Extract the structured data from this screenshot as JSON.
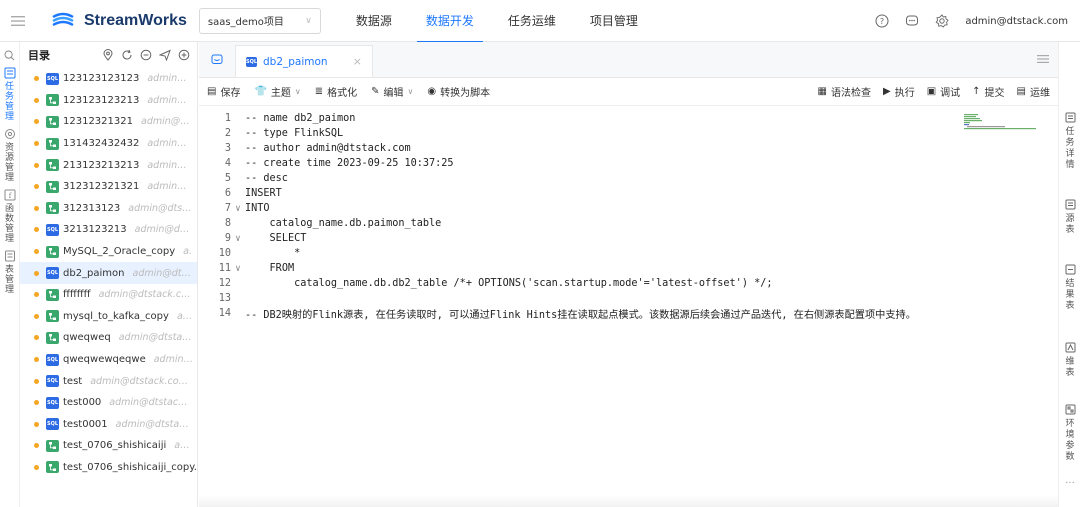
{
  "app": {
    "name": "StreamWorks"
  },
  "project_select": {
    "value": "saas_demo项目"
  },
  "topnav": [
    {
      "label": "数据源"
    },
    {
      "label": "数据开发"
    },
    {
      "label": "任务运维"
    },
    {
      "label": "项目管理"
    }
  ],
  "user": {
    "name": "admin@dtstack.com"
  },
  "rail": [
    {
      "label": "任务管理",
      "icon": "task-icon"
    },
    {
      "label": "资源管理",
      "icon": "resource-icon"
    },
    {
      "label": "函数管理",
      "icon": "function-icon"
    },
    {
      "label": "表管理",
      "icon": "table-icon"
    }
  ],
  "catalog": {
    "title": "目录",
    "items": [
      {
        "type": "SQL",
        "name": "123123123123",
        "owner": "admin@d..."
      },
      {
        "type": "flow",
        "name": "123123123213",
        "owner": "admin@d..."
      },
      {
        "type": "flow",
        "name": "12312321321",
        "owner": "admin@dt..."
      },
      {
        "type": "flow",
        "name": "131432432432",
        "owner": "admin@d..."
      },
      {
        "type": "flow",
        "name": "213123213213",
        "owner": "admin@d..."
      },
      {
        "type": "flow",
        "name": "312312321321",
        "owner": "admin@d..."
      },
      {
        "type": "flow",
        "name": "312313123",
        "owner": "admin@dtsta..."
      },
      {
        "type": "SQL",
        "name": "3213123213",
        "owner": "admin@dtst..."
      },
      {
        "type": "flow",
        "name": "MySQL_2_Oracle_copy",
        "owner": "a..."
      },
      {
        "type": "SQL",
        "name": "db2_paimon",
        "owner": "admin@dtst..."
      },
      {
        "type": "flow",
        "name": "ffffffff",
        "owner": "admin@dtstack.co..."
      },
      {
        "type": "flow",
        "name": "mysql_to_kafka_copy",
        "owner": "ad..."
      },
      {
        "type": "flow",
        "name": "qweqweq",
        "owner": "admin@dtstack..."
      },
      {
        "type": "SQL",
        "name": "qweqwewqeqwe",
        "owner": "admin@..."
      },
      {
        "type": "SQL",
        "name": "test",
        "owner": "admin@dtstack.com..."
      },
      {
        "type": "SQL",
        "name": "test000",
        "owner": "admin@dtstack.c..."
      },
      {
        "type": "SQL",
        "name": "test0001",
        "owner": "admin@dtstack..."
      },
      {
        "type": "flow",
        "name": "test_0706_shishicaiji",
        "owner": "ad..."
      },
      {
        "type": "flow",
        "name": "test_0706_shishicaiji_copy...",
        "owner": ""
      }
    ]
  },
  "tab": {
    "label": "db2_paimon",
    "type": "SQL"
  },
  "toolbar": {
    "left": [
      {
        "label": "保存",
        "icon": "save-icon",
        "dropdown": false
      },
      {
        "label": "主题",
        "icon": "theme-icon",
        "dropdown": true
      },
      {
        "label": "格式化",
        "icon": "format-icon",
        "dropdown": false
      },
      {
        "label": "编辑",
        "icon": "edit-icon",
        "dropdown": true
      },
      {
        "label": "转换为脚本",
        "icon": "convert-icon",
        "dropdown": false
      }
    ],
    "right": [
      {
        "label": "语法检查",
        "icon": "syntax-check-icon"
      },
      {
        "label": "执行",
        "icon": "run-icon"
      },
      {
        "label": "调试",
        "icon": "debug-icon"
      },
      {
        "label": "提交",
        "icon": "submit-icon"
      },
      {
        "label": "运维",
        "icon": "ops-icon"
      }
    ]
  },
  "code": [
    {
      "n": "1",
      "fold": "",
      "text": "-- name db2_paimon",
      "cls": "c-comment",
      "indent": ""
    },
    {
      "n": "2",
      "fold": "",
      "text": "-- type FlinkSQL",
      "cls": "c-comment",
      "indent": ""
    },
    {
      "n": "3",
      "fold": "",
      "text": "-- author admin@dtstack.com",
      "cls": "c-comment",
      "indent": ""
    },
    {
      "n": "4",
      "fold": "",
      "text": "-- create time 2023-09-25 10:37:25",
      "cls": "c-comment",
      "indent": ""
    },
    {
      "n": "5",
      "fold": "",
      "text": "-- desc",
      "cls": "c-comment",
      "indent": ""
    },
    {
      "n": "6",
      "fold": "",
      "text": "INSERT",
      "cls": "c-kw",
      "indent": ""
    },
    {
      "n": "7",
      "fold": "∨",
      "text": "INTO",
      "cls": "c-kw",
      "indent": ""
    },
    {
      "n": "8",
      "fold": "",
      "text": "catalog_name.db.paimon_table",
      "cls": "c-plain",
      "indent": "    "
    },
    {
      "n": "9",
      "fold": "∨",
      "text": "SELECT",
      "cls": "c-kw",
      "indent": "    "
    },
    {
      "n": "10",
      "fold": "",
      "text": "*",
      "cls": "c-plain",
      "indent": "        "
    },
    {
      "n": "11",
      "fold": "∨",
      "text": "FROM",
      "cls": "c-kw",
      "indent": "    "
    },
    {
      "n": "12",
      "fold": "",
      "text": "catalog_name.db.db2_table /*+ OPTIONS('scan.startup.mode'='latest-offset') */;",
      "cls": "c-plain",
      "indent": "        "
    },
    {
      "n": "13",
      "fold": "",
      "text": "",
      "cls": "c-plain",
      "indent": ""
    },
    {
      "n": "14",
      "fold": "",
      "text": "-- DB2映射的Flink源表, 在任务读取时, 可以通过Flink Hints挂在读取起点模式。该数据源后续会通过产品迭代, 在右侧源表配置项中支持。",
      "cls": "c-comment",
      "indent": ""
    }
  ],
  "right_rail": [
    {
      "label": "任务详情",
      "icon": "task-detail-icon"
    },
    {
      "label": "源表",
      "icon": "source-table-icon"
    },
    {
      "label": "结果表",
      "icon": "result-table-icon"
    },
    {
      "label": "维表",
      "icon": "dimension-table-icon"
    },
    {
      "label": "环境参数",
      "icon": "env-params-icon"
    }
  ],
  "right_rail_more": "···",
  "colors": {
    "accent": "#1d78ff",
    "folder_dot": "#f5a623",
    "sql_badge": "#2d6be4",
    "flow_badge": "#3aa76d"
  }
}
